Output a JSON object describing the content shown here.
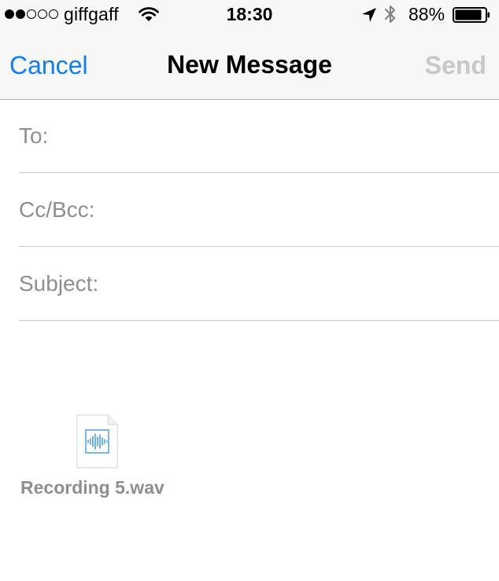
{
  "status_bar": {
    "signal_dots_filled": 2,
    "signal_dots_total": 5,
    "carrier": "giffgaff",
    "time": "18:30",
    "battery_percent": "88%",
    "icons": [
      "signal-dots-icon",
      "wifi-icon",
      "location-arrow-icon",
      "bluetooth-icon",
      "battery-icon"
    ]
  },
  "nav": {
    "cancel_label": "Cancel",
    "title": "New Message",
    "send_label": "Send"
  },
  "fields": {
    "to_label": "To:",
    "to_value": "",
    "cc_label": "Cc/Bcc:",
    "cc_value": "",
    "subject_label": "Subject:",
    "subject_value": ""
  },
  "attachment": {
    "filename": "Recording 5.wav",
    "icon": "audio-file-icon"
  },
  "colors": {
    "accent": "#0f7ef5",
    "send_disabled": "#c7c7cc",
    "label_gray": "#8e8e93",
    "header_bg": "#f7f7f7",
    "separator": "#c8c7cc"
  }
}
